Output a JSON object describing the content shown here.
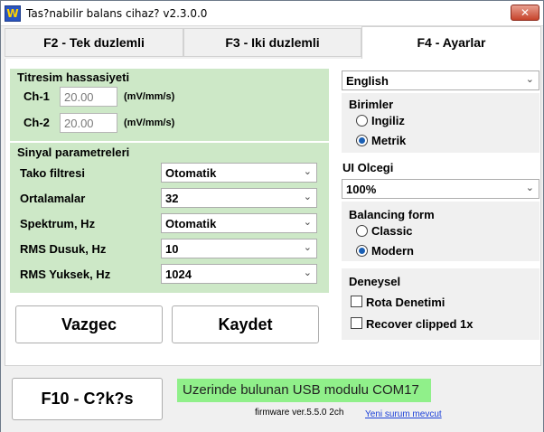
{
  "window": {
    "icon_letter": "W",
    "title": "Tas?nabilir balans cihaz? v2.3.0.0",
    "close_label": "✕"
  },
  "tabs": [
    {
      "label": "F2 - Tek duzlemli",
      "active": false
    },
    {
      "label": "F3 - Iki duzlemli",
      "active": false
    },
    {
      "label": "F4 - Ayarlar",
      "active": true
    }
  ],
  "vibration": {
    "title": "Titresim hassasiyeti",
    "channels": [
      {
        "label": "Ch-1",
        "value": "20.00",
        "unit": "(mV/mm/s)"
      },
      {
        "label": "Ch-2",
        "value": "20.00",
        "unit": "(mV/mm/s)"
      }
    ]
  },
  "signal": {
    "title": "Sinyal parametreleri",
    "rows": [
      {
        "label": "Tako filtresi",
        "value": "Otomatik"
      },
      {
        "label": "Ortalamalar",
        "value": "32"
      },
      {
        "label": "Spektrum, Hz",
        "value": "Otomatik"
      },
      {
        "label": "RMS Dusuk, Hz",
        "value": "10"
      },
      {
        "label": "RMS Yuksek, Hz",
        "value": "1024"
      }
    ]
  },
  "buttons": {
    "cancel": "Vazgec",
    "save": "Kaydet",
    "exit": "F10 - C?k?s"
  },
  "language": {
    "value": "English"
  },
  "units": {
    "title": "Birimler",
    "options": [
      {
        "label": "Ingiliz",
        "checked": false
      },
      {
        "label": "Metrik",
        "checked": true
      }
    ]
  },
  "ui_scale": {
    "title": "UI Olcegi",
    "value": "100%"
  },
  "balancing_form": {
    "title": "Balancing form",
    "options": [
      {
        "label": "Classic",
        "checked": false
      },
      {
        "label": "Modern",
        "checked": true
      }
    ]
  },
  "experimental": {
    "title": "Deneysel",
    "options": [
      {
        "label": "Rota Denetimi",
        "checked": false
      },
      {
        "label": "Recover clipped 1x",
        "checked": false
      }
    ]
  },
  "status": {
    "usb_message": "Uzerinde bulunan USB modulu COM17",
    "firmware": "firmware ver.5.5.0 2ch",
    "update_link": "Yeni surum mevcut"
  },
  "colors": {
    "group_background": "#cde8c7",
    "status_background": "#90f08a",
    "link": "#1a3fd8",
    "radio_dot": "#1a5fb4"
  }
}
